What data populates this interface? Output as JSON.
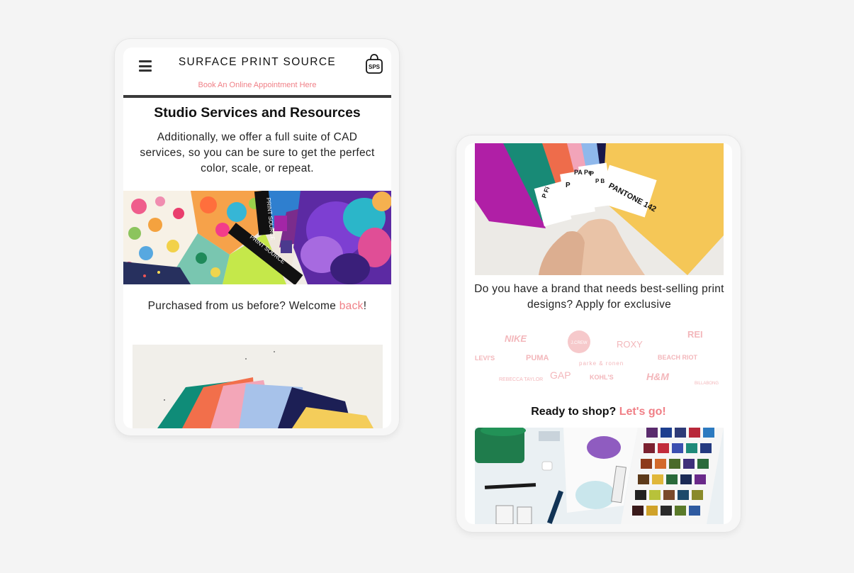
{
  "phone1": {
    "header": {
      "menu_icon": "hamburger-menu-icon",
      "brand": "SURFACE PRINT SOURCE",
      "bag_icon": "shopping-bag-icon",
      "bag_text": "SPS",
      "appointment_link": "Book An Online Appointment Here"
    },
    "section_title": "Studio Services and Resources",
    "cad_text": "Additionally, we offer a full suite of CAD services, so you can be sure to get the perfect color, scale, or repeat.",
    "welcome_text": "Purchased from us before? Welcome",
    "welcome_link": "back",
    "welcome_suffix": "!",
    "banner_text_1": "PRINT SOURCE",
    "banner_text_2": "PRINT SOURCE"
  },
  "phone2": {
    "pantone_cards": [
      "P Fi",
      "P",
      "PA Pe",
      "P",
      "P B",
      "PANTONE 142"
    ],
    "brand_question": "Do you have a brand that needs best-selling print designs? Apply for exclusive",
    "logos": [
      "NIKE",
      "J.CREW",
      "ROXY",
      "REI",
      "LEVI'S",
      "PUMA",
      "parke & ronen",
      "BEACH RIOT",
      "REBECCA TAYLOR",
      "GAP",
      "KOHL'S",
      "H&M",
      "BILLABONG"
    ],
    "shop_text": "Ready to shop?",
    "shop_link": "Let's go!"
  },
  "colors": {
    "accent": "#f07f86",
    "text": "#111111",
    "background": "#f4f4f4"
  }
}
